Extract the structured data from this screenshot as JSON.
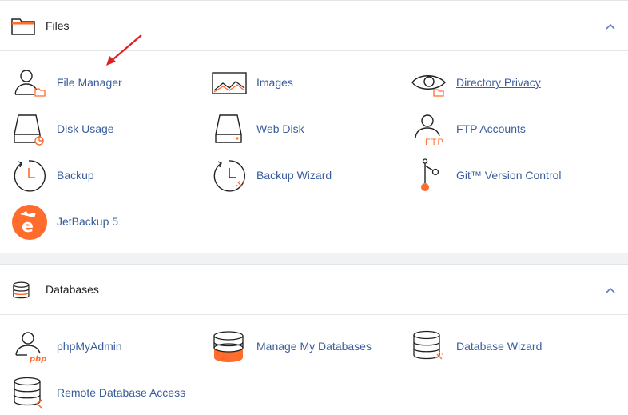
{
  "files": {
    "title": "Files",
    "items": [
      {
        "label": "File Manager",
        "icon": "file-manager-icon"
      },
      {
        "label": "Images",
        "icon": "images-icon"
      },
      {
        "label": "Directory Privacy",
        "icon": "directory-privacy-icon"
      },
      {
        "label": "Disk Usage",
        "icon": "disk-usage-icon"
      },
      {
        "label": "Web Disk",
        "icon": "web-disk-icon"
      },
      {
        "label": "FTP Accounts",
        "icon": "ftp-accounts-icon"
      },
      {
        "label": "Backup",
        "icon": "backup-icon"
      },
      {
        "label": "Backup Wizard",
        "icon": "backup-wizard-icon"
      },
      {
        "label": "Git™ Version Control",
        "icon": "git-version-control-icon"
      },
      {
        "label": "JetBackup 5",
        "icon": "jetbackup-icon"
      }
    ]
  },
  "databases": {
    "title": "Databases",
    "items": [
      {
        "label": "phpMyAdmin",
        "icon": "phpmyadmin-icon"
      },
      {
        "label": "Manage My Databases",
        "icon": "manage-databases-icon"
      },
      {
        "label": "Database Wizard",
        "icon": "database-wizard-icon"
      },
      {
        "label": "Remote Database Access",
        "icon": "remote-database-access-icon"
      }
    ]
  },
  "icon_texts": {
    "ftp": "FTP",
    "php": "php",
    "jetbackup_glyph": "e"
  },
  "colors": {
    "accent": "#ff6c2c",
    "link": "#3a5e9b",
    "annotation_arrow": "#e02020"
  }
}
